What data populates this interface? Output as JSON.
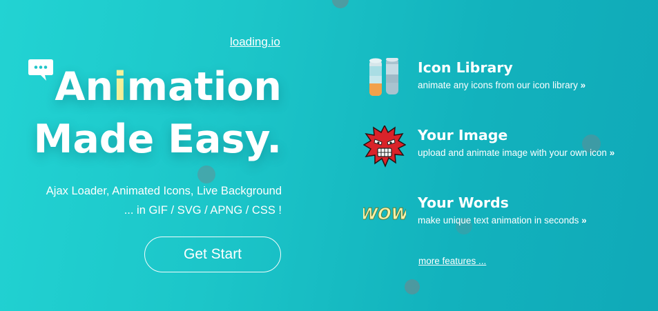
{
  "brand": {
    "link_text": "loading.io"
  },
  "hero": {
    "title_line1_before": "An",
    "title_line1_highlight": "i",
    "title_line1_after": "mation",
    "title_line2": "Made Easy.",
    "subtitle_line1": "Ajax Loader, Animated Icons, Live Background",
    "subtitle_line2": "... in GIF / SVG / APNG / CSS !",
    "cta_label": "Get Start"
  },
  "features": [
    {
      "icon": "battery-columns-icon",
      "title": "Icon Library",
      "description": "animate any icons from our icon library",
      "arrow": "»"
    },
    {
      "icon": "angry-monster-icon",
      "title": "Your Image",
      "description": "upload and animate image with your own icon",
      "arrow": "»"
    },
    {
      "icon": "wow-text-icon",
      "title": "Your Words",
      "description": "make unique text animation in seconds",
      "arrow": "»",
      "icon_text": "WOW"
    }
  ],
  "more_features": "more features ...",
  "colors": {
    "background_start": "#22d3d3",
    "background_end": "#10a9b8",
    "highlight": "#f4f19a",
    "dot": "#6a8a8f"
  }
}
